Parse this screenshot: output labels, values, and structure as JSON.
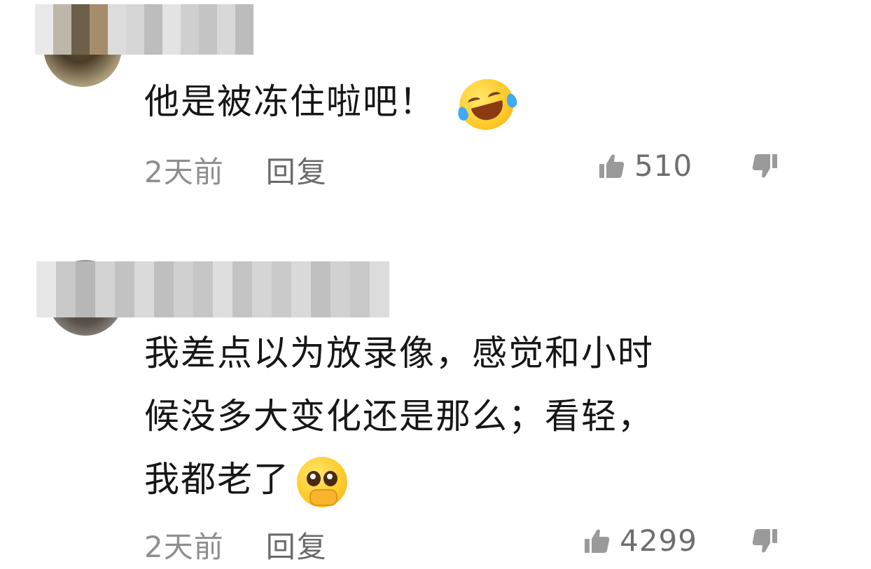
{
  "comments": [
    {
      "text": "他是被冻住啦吧！",
      "emoji": "face-with-tears-of-joy-icon",
      "time": "2天前",
      "reply_label": "回复",
      "likes": "510"
    },
    {
      "text": "我差点以为放录像，感觉和小时\n候没多大变化还是那么；看轻，\n我都老了",
      "emoji": "pleading-face-icon",
      "time": "2天前",
      "reply_label": "回复",
      "likes": "4299"
    }
  ],
  "colors": {
    "text": "#161616",
    "meta": "#8e8e8e",
    "icon": "#9a9a9a",
    "background": "#ffffff"
  }
}
